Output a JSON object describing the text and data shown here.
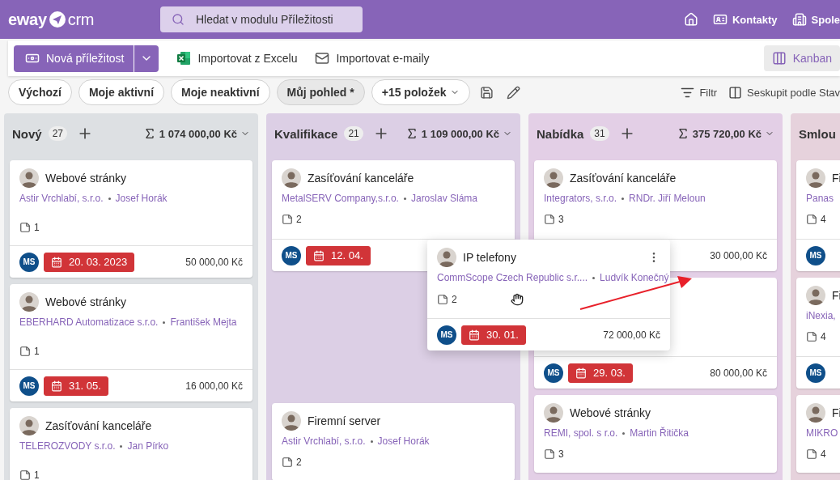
{
  "topbar": {
    "logo_left": "eway",
    "logo_right": "crm",
    "search": {
      "placeholder": "Hledat v modulu Příležitosti"
    },
    "nav": [
      {
        "kind": "home"
      },
      {
        "kind": "contacts",
        "label": "Kontakty"
      },
      {
        "kind": "companies",
        "label": "Spole"
      }
    ]
  },
  "toolbar": {
    "new_button": "Nová příležitost",
    "actions": [
      {
        "kind": "excel",
        "label": "Importovat z Excelu"
      },
      {
        "kind": "mail",
        "label": "Importovat e-maily"
      }
    ],
    "view": {
      "label": "Kanban",
      "selected": true
    }
  },
  "filters": {
    "views": [
      {
        "label": "Výchozí",
        "selected": false
      },
      {
        "label": "Moje aktivní",
        "selected": false
      },
      {
        "label": "Moje neaktivní",
        "selected": false
      },
      {
        "label": "Můj pohled *",
        "selected": true
      }
    ],
    "more": "+15 položek",
    "filter": "Filtr",
    "group": "Seskupit podle Stav"
  },
  "columns": [
    {
      "title": "Nový",
      "count": "27",
      "total": "1 074 000,00 Kč",
      "color": "#dde0e3",
      "cards": [
        {
          "title": "Webové stránky",
          "company": "Astir Vrchlabí, s.r.o.",
          "contact": "Josef Horák",
          "notes": "1",
          "owner": "MS",
          "date": "20. 03. 2023",
          "overdue": true,
          "amount": "50 000,00 Kč"
        },
        {
          "title": "Webové stránky",
          "company": "EBERHARD Automatizace s.r.o.",
          "contact": "František Mejta",
          "notes": "1",
          "owner": "MS",
          "date": "31. 05.",
          "overdue": true,
          "amount": "16 000,00 Kč"
        },
        {
          "title": "Zasíťování kanceláře",
          "company": "TELEROZVODY s.r.o.",
          "contact": "Jan Pírko",
          "notes": "1"
        }
      ]
    },
    {
      "title": "Kvalifikace",
      "count": "21",
      "total": "1 109 000,00 Kč",
      "color": "#dccfe5",
      "cards": [
        {
          "title": "Zasíťování kanceláře",
          "company": "MetalSERV Company,s.r.o.",
          "contact": "Jaroslav Sláma",
          "notes": "2",
          "owner": "MS",
          "date": "12. 04.",
          "overdue": true
        },
        {
          "kind": "placeholder"
        },
        {
          "title": "Firemní server",
          "company": "Astir Vrchlabí, s.r.o.",
          "contact": "Josef Horák",
          "notes": "2"
        }
      ]
    },
    {
      "title": "Nabídka",
      "count": "31",
      "total": "375 720,00 Kč",
      "color": "#e3cfe6",
      "cards": [
        {
          "title": "Zasíťování kanceláře",
          "company": "Integrators, s.r.o.",
          "contact": "RNDr. Jiří Meloun",
          "notes": "3",
          "amount": "30 000,00 Kč"
        },
        {
          "owner": "MS",
          "date": "29. 03.",
          "overdue": true,
          "amount": "80 000,00 Kč"
        },
        {
          "title": "Webové stránky",
          "company": "REMI, spol. s r.o.",
          "contact": "Martin Řitička",
          "notes": "3"
        }
      ]
    },
    {
      "title": "Smlou",
      "color": "#e6d2dc",
      "cards": [
        {
          "title": "Fi",
          "company": "Panas",
          "notes": "4",
          "owner": "MS"
        },
        {
          "title": "Fi",
          "company": "iNexia,",
          "notes": "4",
          "owner": "MS"
        },
        {
          "title": "Fi",
          "company": "MIKRO",
          "notes": "4"
        }
      ]
    }
  ],
  "dragged_card": {
    "title": "IP telefony",
    "company": "CommScope Czech Republic s.r....",
    "contact": "Ludvík Konečný",
    "notes": "2",
    "owner": "MS",
    "date": "30. 01.",
    "overdue": true,
    "amount": "72 000,00 Kč"
  }
}
